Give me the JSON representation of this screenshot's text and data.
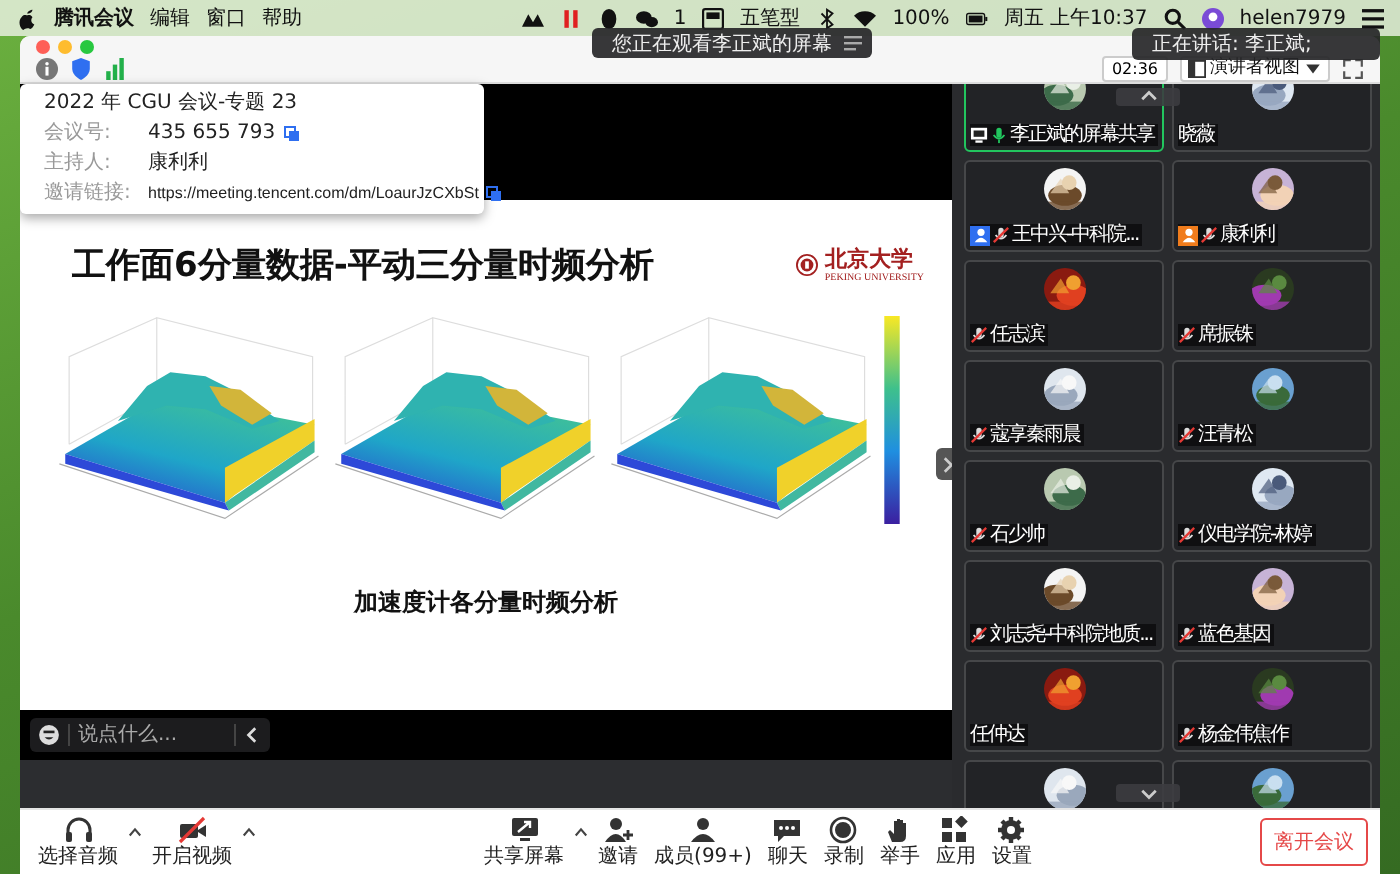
{
  "menu_bar": {
    "app": "腾讯会议",
    "menus": [
      "编辑",
      "窗口",
      "帮助"
    ],
    "notification_count": "1",
    "input_method": "五笔型",
    "battery": "100%",
    "clock": "周五 上午10:37",
    "user": "helen7979"
  },
  "banner": {
    "text": "您正在观看李正斌的屏幕"
  },
  "speaking": {
    "text": "正在讲话: 李正斌;"
  },
  "toolbar": {
    "timer": "02:36",
    "view": "演讲者视图"
  },
  "meeting_info": {
    "title": "2022 年 CGU 会议-专题 23",
    "rows": [
      {
        "label": "会议号:",
        "value": "435 655 793",
        "copy": true
      },
      {
        "label": "主持人:",
        "value": "康利利",
        "copy": false
      },
      {
        "label": "邀请链接:",
        "value": "https://meeting.tencent.com/dm/LoaurJzCXbSt",
        "copy": true
      }
    ]
  },
  "slide": {
    "title": "工作面6分量数据-平动三分量时频分析",
    "logo_name": "北京大学",
    "logo_subtitle": "PEKING UNIVERSITY",
    "plots": [
      {
        "kind": "surface"
      },
      {
        "kind": "surface"
      },
      {
        "kind": "surface"
      }
    ],
    "subtitle": "加速度计各分量时频分析"
  },
  "chat": {
    "placeholder": "说点什么..."
  },
  "participants": [
    {
      "name": "李正斌的屏幕共享",
      "active": true,
      "sharing": true,
      "muted": false
    },
    {
      "name": "晓薇",
      "active": false
    },
    {
      "name": "王中兴-中科院...",
      "active": false,
      "muted": true,
      "color": "#2f6ff0"
    },
    {
      "name": "康利利",
      "active": false,
      "muted": true,
      "color": "#f07c1c"
    },
    {
      "name": "任志滨",
      "active": false,
      "muted": true
    },
    {
      "name": "席振铢",
      "active": false,
      "muted": true
    },
    {
      "name": "蔻享秦雨晨",
      "active": false,
      "muted": true
    },
    {
      "name": "汪青松",
      "active": false,
      "muted": true
    },
    {
      "name": "石少帅",
      "active": false,
      "muted": true
    },
    {
      "name": "仪电学院-林婷",
      "active": false,
      "muted": true
    },
    {
      "name": "刘志尧-中科院地质...",
      "active": false,
      "muted": true
    },
    {
      "name": "蓝色基因",
      "active": false,
      "muted": true
    },
    {
      "name": "任仲达",
      "active": false
    },
    {
      "name": "杨金伟焦作",
      "active": false,
      "muted": true
    },
    {
      "active": false
    },
    {
      "active": false
    }
  ],
  "controls": {
    "left": [
      {
        "label": "选择音频",
        "kind": "headphones",
        "menu": true
      },
      {
        "label": "开启视频",
        "kind": "camera_off",
        "menu": true
      }
    ],
    "center": [
      {
        "label": "共享屏幕",
        "kind": "share",
        "menu": true
      },
      {
        "label": "邀请",
        "kind": "invite",
        "menu": false
      },
      {
        "label": "成员(99+)",
        "kind": "members",
        "menu": false
      },
      {
        "label": "聊天",
        "kind": "chat",
        "menu": false
      },
      {
        "label": "录制",
        "kind": "record",
        "menu": false
      },
      {
        "label": "举手",
        "kind": "hand",
        "menu": false
      },
      {
        "label": "应用",
        "kind": "apps",
        "menu": false
      },
      {
        "label": "设置",
        "kind": "settings",
        "menu": false
      }
    ],
    "leave": "离开会议"
  }
}
